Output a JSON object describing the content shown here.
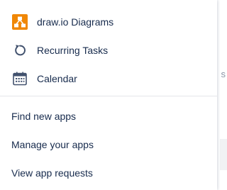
{
  "apps": [
    {
      "label": "draw.io Diagrams",
      "icon": "drawio-icon",
      "color": "#f08705"
    },
    {
      "label": "Recurring Tasks",
      "icon": "recurring-refresh-icon",
      "color": "#42526e"
    },
    {
      "label": "Calendar",
      "icon": "calendar-icon",
      "color": "#42526e"
    }
  ],
  "links": [
    {
      "label": "Find new apps"
    },
    {
      "label": "Manage your apps"
    },
    {
      "label": "View app requests"
    }
  ],
  "backdrop": {
    "glyph": "s"
  }
}
